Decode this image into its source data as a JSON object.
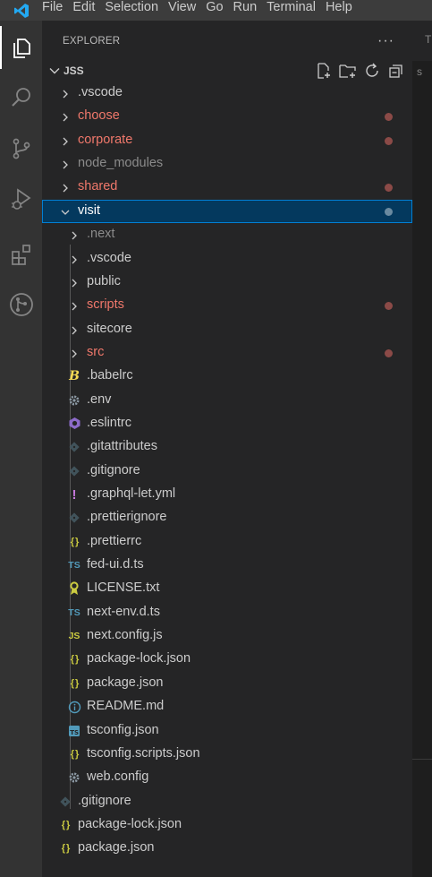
{
  "menu": [
    "File",
    "Edit",
    "Selection",
    "View",
    "Go",
    "Run",
    "Terminal",
    "Help"
  ],
  "activity_icons": [
    "files-icon",
    "search-icon",
    "source-control-icon",
    "run-debug-icon",
    "extensions-icon",
    "git-graph-icon"
  ],
  "explorer": {
    "title": "EXPLORER",
    "more": "···",
    "root": "JSS",
    "root_actions": [
      "new-file-icon",
      "new-folder-icon",
      "refresh-icon",
      "collapse-all-icon"
    ]
  },
  "colors": {
    "modified": "#f0786b",
    "dim": "#8b8b8b",
    "default": "#cccccc",
    "dot_modified": "#8b4a47",
    "dot_selected": "#6a8aa0"
  },
  "tree": [
    {
      "label": ".vscode",
      "type": "folder",
      "depth": 0,
      "state": "default"
    },
    {
      "label": "choose",
      "type": "folder",
      "depth": 0,
      "state": "modified"
    },
    {
      "label": "corporate",
      "type": "folder",
      "depth": 0,
      "state": "modified"
    },
    {
      "label": "node_modules",
      "type": "folder",
      "depth": 0,
      "state": "dim"
    },
    {
      "label": "shared",
      "type": "folder",
      "depth": 0,
      "state": "modified"
    },
    {
      "label": "visit",
      "type": "folder",
      "depth": 0,
      "state": "selected",
      "expanded": true
    },
    {
      "label": ".next",
      "type": "folder",
      "depth": 1,
      "state": "dim"
    },
    {
      "label": ".vscode",
      "type": "folder",
      "depth": 1,
      "state": "default"
    },
    {
      "label": "public",
      "type": "folder",
      "depth": 1,
      "state": "default"
    },
    {
      "label": "scripts",
      "type": "folder",
      "depth": 1,
      "state": "modified"
    },
    {
      "label": "sitecore",
      "type": "folder",
      "depth": 1,
      "state": "default"
    },
    {
      "label": "src",
      "type": "folder",
      "depth": 1,
      "state": "modified"
    },
    {
      "label": ".babelrc",
      "type": "file",
      "depth": 1,
      "icon": "babel-icon"
    },
    {
      "label": ".env",
      "type": "file",
      "depth": 1,
      "icon": "gear-icon"
    },
    {
      "label": ".eslintrc",
      "type": "file",
      "depth": 1,
      "icon": "eslint-icon"
    },
    {
      "label": ".gitattributes",
      "type": "file",
      "depth": 1,
      "icon": "git-icon"
    },
    {
      "label": ".gitignore",
      "type": "file",
      "depth": 1,
      "icon": "git-icon"
    },
    {
      "label": ".graphql-let.yml",
      "type": "file",
      "depth": 1,
      "icon": "exclamation-icon"
    },
    {
      "label": ".prettierignore",
      "type": "file",
      "depth": 1,
      "icon": "git-icon"
    },
    {
      "label": ".prettierrc",
      "type": "file",
      "depth": 1,
      "icon": "json-icon"
    },
    {
      "label": "fed-ui.d.ts",
      "type": "file",
      "depth": 1,
      "icon": "typescript-icon"
    },
    {
      "label": "LICENSE.txt",
      "type": "file",
      "depth": 1,
      "icon": "license-icon"
    },
    {
      "label": "next-env.d.ts",
      "type": "file",
      "depth": 1,
      "icon": "typescript-icon"
    },
    {
      "label": "next.config.js",
      "type": "file",
      "depth": 1,
      "icon": "javascript-icon"
    },
    {
      "label": "package-lock.json",
      "type": "file",
      "depth": 1,
      "icon": "json-icon"
    },
    {
      "label": "package.json",
      "type": "file",
      "depth": 1,
      "icon": "json-icon"
    },
    {
      "label": "README.md",
      "type": "file",
      "depth": 1,
      "icon": "info-icon"
    },
    {
      "label": "tsconfig.json",
      "type": "file",
      "depth": 1,
      "icon": "tsconfig-icon"
    },
    {
      "label": "tsconfig.scripts.json",
      "type": "file",
      "depth": 1,
      "icon": "json-icon"
    },
    {
      "label": "web.config",
      "type": "file",
      "depth": 1,
      "icon": "gear-icon"
    },
    {
      "label": ".gitignore",
      "type": "file",
      "depth": 0,
      "icon": "git-icon"
    },
    {
      "label": "package-lock.json",
      "type": "file",
      "depth": 0,
      "icon": "json-icon"
    },
    {
      "label": "package.json",
      "type": "file",
      "depth": 0,
      "icon": "json-icon"
    }
  ],
  "editor": {
    "tab_fragment": "T",
    "crumb_fragment": "s"
  }
}
